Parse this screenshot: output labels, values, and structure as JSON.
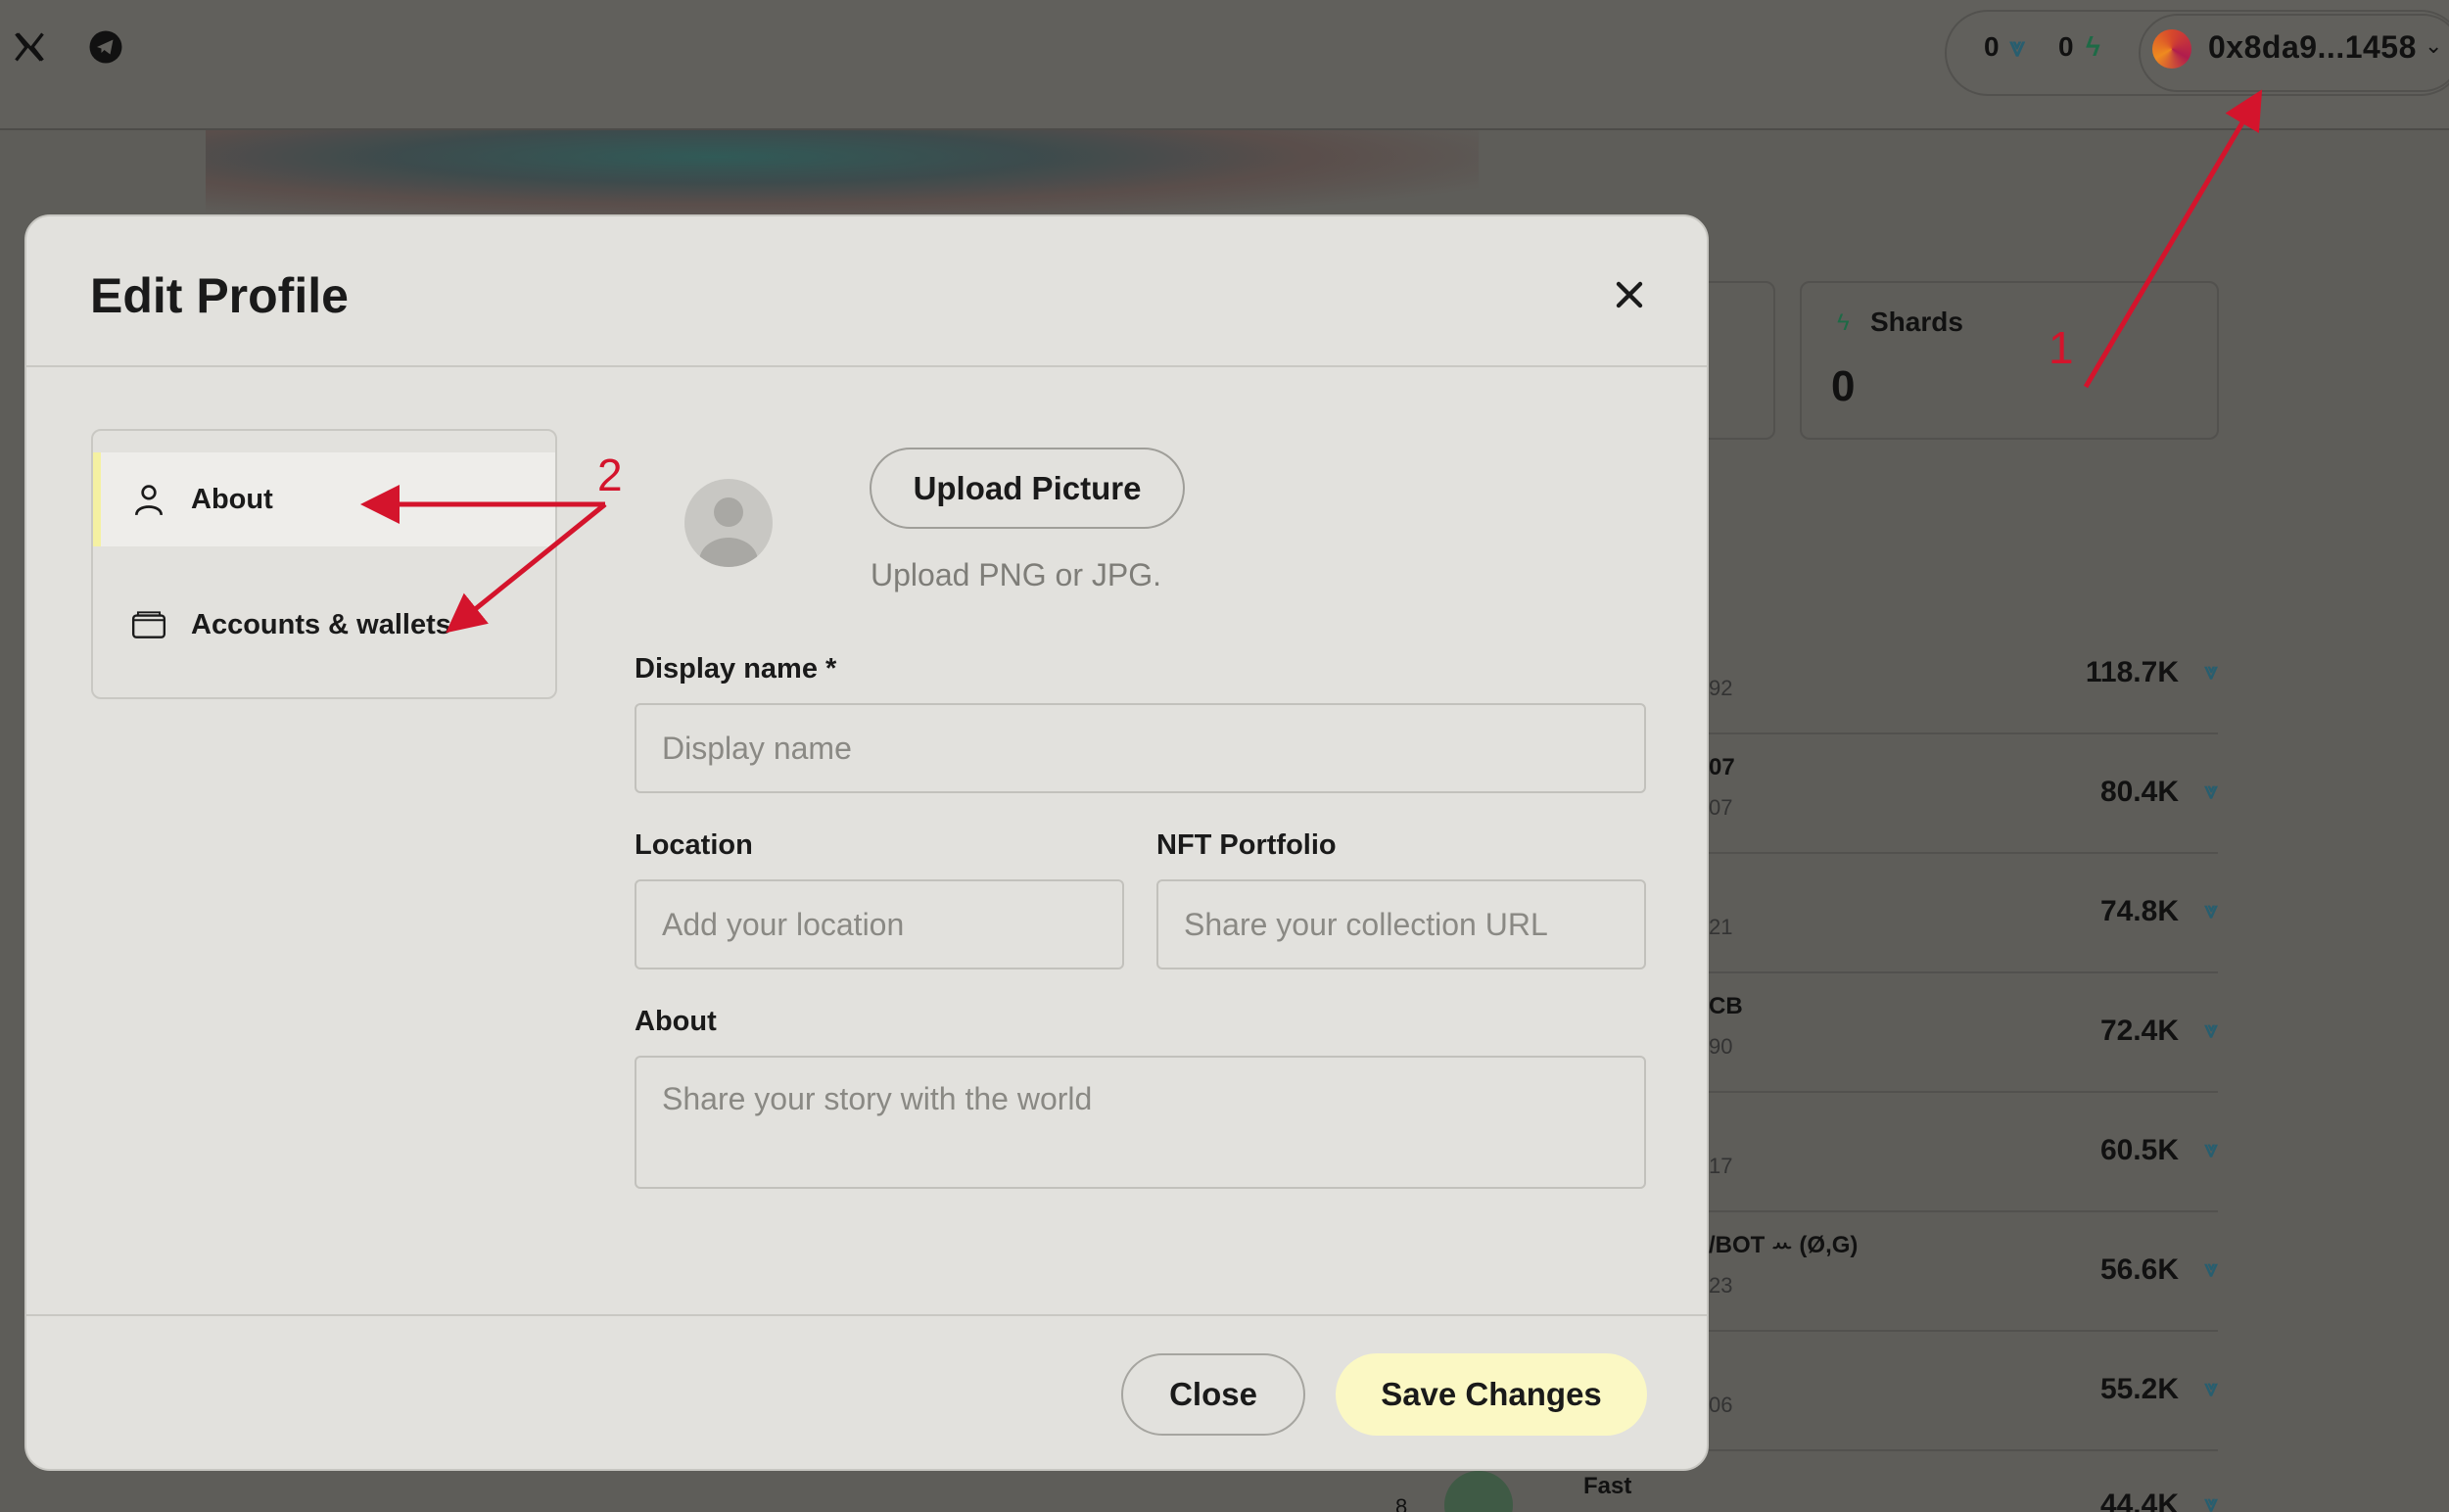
{
  "header": {
    "x_icon": "x-logo-icon",
    "telegram_icon": "telegram-icon",
    "token_count": "0",
    "shard_count": "0",
    "wallet_address": "0x8da9...1458"
  },
  "stats": {
    "shards_label": "Shards",
    "shards_value": "0"
  },
  "leaderboard": {
    "rows": [
      {
        "name": "",
        "sub": "92",
        "value": "118.7K"
      },
      {
        "name": "07",
        "sub": "07",
        "value": "80.4K"
      },
      {
        "name": "",
        "sub": "21",
        "value": "74.8K"
      },
      {
        "name": "CB",
        "sub": "90",
        "value": "72.4K"
      },
      {
        "name": "",
        "sub": "17",
        "value": "60.5K"
      },
      {
        "name": "/BOT ꕀ (Ø,G)",
        "sub": "23",
        "value": "56.6K"
      },
      {
        "name": "",
        "sub": "06",
        "value": "55.2K"
      },
      {
        "name": "Fast",
        "sub": "8",
        "value": "44.4K"
      }
    ]
  },
  "modal": {
    "title": "Edit Profile",
    "nav": [
      {
        "label": "About",
        "icon": "user-icon",
        "active": true
      },
      {
        "label": "Accounts & wallets",
        "icon": "wallet-icon",
        "active": false
      }
    ],
    "upload_label": "Upload Picture",
    "upload_hint": "Upload PNG or JPG.",
    "display_name": {
      "label": "Display name *",
      "placeholder": "Display name",
      "value": ""
    },
    "location": {
      "label": "Location",
      "placeholder": "Add your location",
      "value": ""
    },
    "nft_portfolio": {
      "label": "NFT Portfolio",
      "placeholder": "Share your collection URL",
      "value": ""
    },
    "about": {
      "label": "About",
      "placeholder": "Share your story with the world",
      "value": ""
    },
    "close_label": "Close",
    "save_label": "Save Changes"
  },
  "annotations": {
    "marker_1": "1",
    "marker_2": "2",
    "color": "#d4142c"
  },
  "colors": {
    "save_button": "#fbf8c4",
    "active_nav_accent": "#f5f1a2",
    "modal_bg": "#e2e1dd"
  }
}
